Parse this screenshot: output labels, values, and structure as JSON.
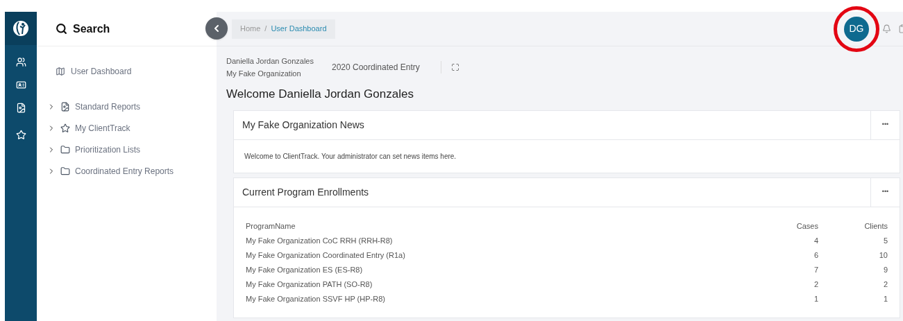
{
  "sidebar": {
    "search_label": "Search",
    "items": [
      {
        "kind": "link",
        "label": "User Dashboard"
      },
      {
        "kind": "group",
        "label": "Standard Reports",
        "expanded": false
      },
      {
        "kind": "group",
        "label": "My ClientTrack",
        "expanded": false
      },
      {
        "kind": "group",
        "label": "Prioritization Lists",
        "expanded": false
      },
      {
        "kind": "group",
        "label": "Coordinated Entry Reports",
        "expanded": false
      }
    ]
  },
  "breadcrumb": [
    {
      "label": "Home",
      "selected": false
    },
    {
      "label": "User Dashboard",
      "selected": true
    }
  ],
  "breadcrumb_separator": "/",
  "avatar": {
    "initials": "DG",
    "highlighted": true
  },
  "context": {
    "user": "Daniella Jordan Gonzales",
    "organization": "My Fake Organization",
    "workflow": "2020 Coordinated Entry"
  },
  "welcome": "Welcome Daniella Jordan Gonzales",
  "news": {
    "title": "My Fake Organization News",
    "more": "•••",
    "body": "Welcome to ClientTrack. Your administrator can set news items here."
  },
  "enrollments": {
    "title": "Current Program Enrollments",
    "more": "•••",
    "columns": [
      "ProgramName",
      "Cases",
      "Clients"
    ],
    "rows": [
      [
        "My Fake Organization CoC RRH (RRH-R8)",
        "4",
        "5"
      ],
      [
        "My Fake Organization Coordinated Entry (R1a)",
        "6",
        "10"
      ],
      [
        "My Fake Organization ES (ES-R8)",
        "7",
        "9"
      ],
      [
        "My Fake Organization PATH (SO-R8)",
        "2",
        "2"
      ],
      [
        "My Fake Organization SSVF HP (HP-R8)",
        "1",
        "1"
      ]
    ]
  }
}
